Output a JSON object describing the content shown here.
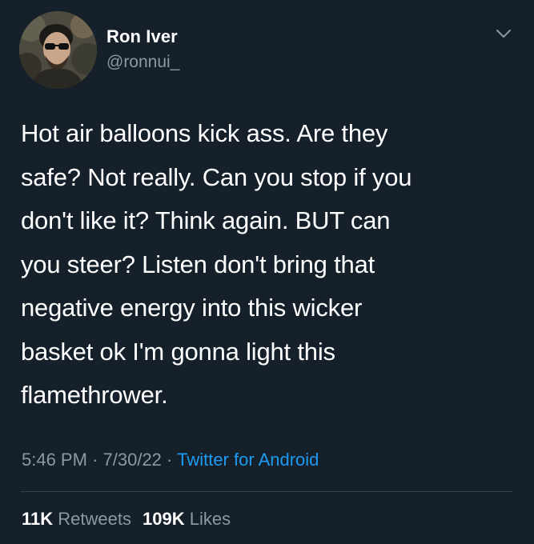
{
  "author": {
    "display_name": "Ron Iver",
    "handle": "@ronnui_"
  },
  "tweet": {
    "text": "Hot air balloons kick ass. Are they\nsafe? Not really. Can you stop if you\ndon't like it? Think again. BUT can\nyou steer? Listen don't bring that\nnegative energy into this wicker\nbasket ok I'm gonna light this\nflamethrower.",
    "time": "5:46 PM",
    "date": "7/30/22",
    "separator": "·",
    "source": "Twitter for Android"
  },
  "stats": {
    "retweets_count": "11K",
    "retweets_label": "Retweets",
    "likes_count": "109K",
    "likes_label": "Likes"
  },
  "icons": {
    "menu": "chevron-down-icon",
    "avatar": "avatar"
  },
  "colors": {
    "background": "#15202b",
    "text": "#ffffff",
    "secondary_text": "#8b98a5",
    "link": "#1d9bf0",
    "divider": "#38444d"
  }
}
